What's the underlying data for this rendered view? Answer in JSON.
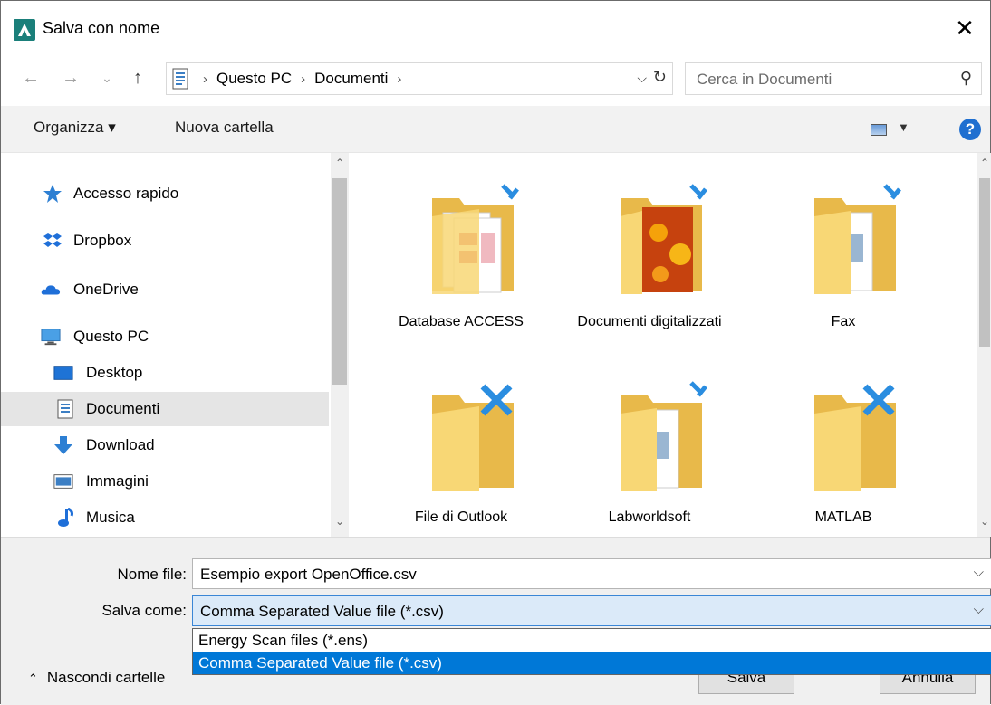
{
  "window": {
    "title": "Salva con nome",
    "close": "✕"
  },
  "nav": {
    "back": "←",
    "forward": "→",
    "recent": "⌄",
    "up": "↑",
    "breadcrumb": [
      "Questo PC",
      "Documenti"
    ],
    "search_placeholder": "Cerca in Documenti"
  },
  "toolbar": {
    "organize": "Organizza ▾",
    "new_folder": "Nuova cartella",
    "help": "?"
  },
  "sidebar": {
    "items": [
      {
        "label": "Accesso rapido",
        "icon": "star-icon"
      },
      {
        "label": "Dropbox",
        "icon": "dropbox-icon"
      },
      {
        "label": "OneDrive",
        "icon": "cloud-icon"
      },
      {
        "label": "Questo PC",
        "icon": "computer-icon"
      },
      {
        "label": "Desktop",
        "icon": "desktop-icon"
      },
      {
        "label": "Documenti",
        "icon": "document-icon",
        "selected": true
      },
      {
        "label": "Download",
        "icon": "download-icon"
      },
      {
        "label": "Immagini",
        "icon": "pictures-icon"
      },
      {
        "label": "Musica",
        "icon": "music-icon"
      }
    ]
  },
  "files": [
    {
      "name": "Database ACCESS"
    },
    {
      "name": "Documenti digitalizzati"
    },
    {
      "name": "Fax"
    },
    {
      "name": "File di Outlook"
    },
    {
      "name": "Labworldsoft"
    },
    {
      "name": "MATLAB"
    }
  ],
  "form": {
    "filename_label": "Nome file:",
    "filename_value": "Esempio export OpenOffice.csv",
    "savetype_label": "Salva come:",
    "savetype_value": "Comma Separated Value file (*.csv)",
    "options": [
      "Energy Scan files (*.ens)",
      "Comma Separated Value file (*.csv)"
    ]
  },
  "footer": {
    "hide_folders": "Nascondi cartelle",
    "save": "Salva",
    "cancel": "Annulla"
  },
  "colors": {
    "accent": "#0078d7",
    "folder": "#f8d775",
    "selection": "#e5e5e5"
  }
}
